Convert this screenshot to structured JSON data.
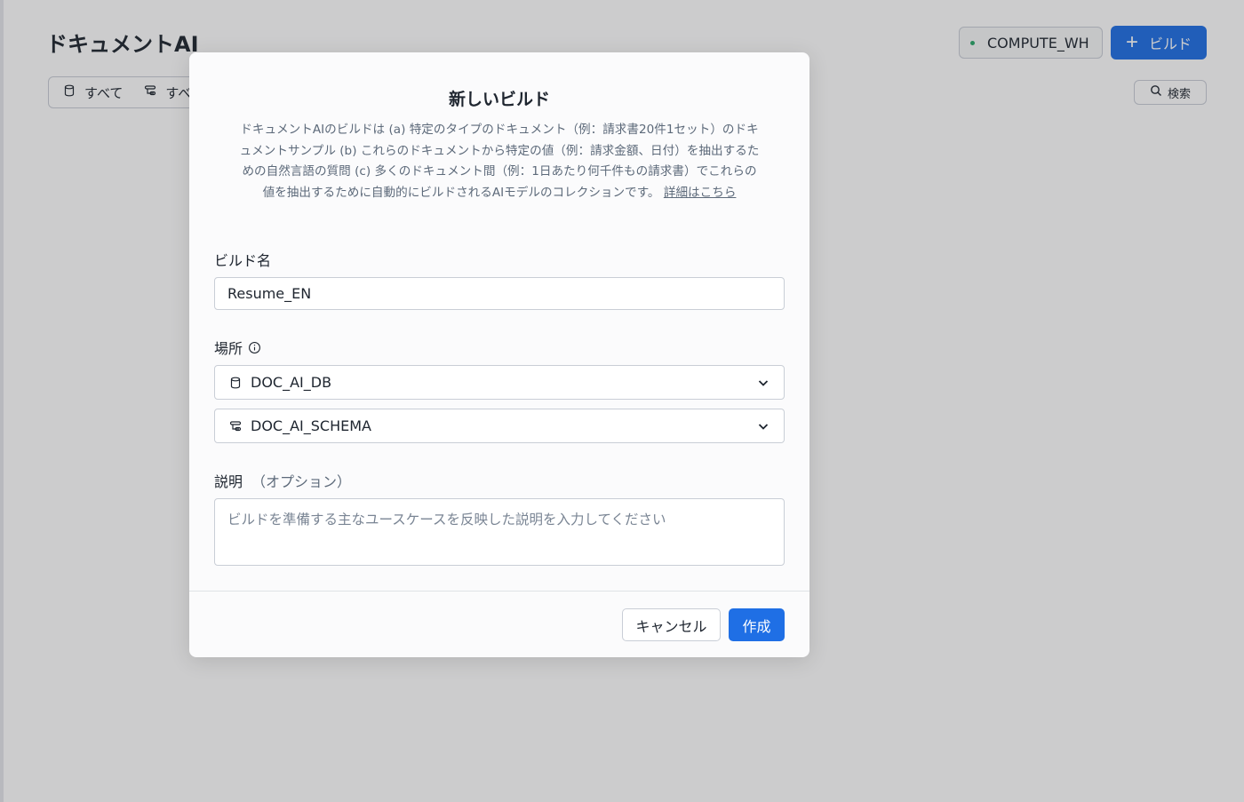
{
  "page": {
    "title": "ドキュメントAI",
    "filters": [
      {
        "icon": "database-icon",
        "label": "すべて"
      },
      {
        "icon": "schema-icon",
        "label": "すべ"
      }
    ],
    "warehouse": {
      "label": "COMPUTE_WH",
      "status_color": "#2aa76a"
    },
    "build_button": {
      "label": "ビルド",
      "icon": "plus-icon"
    },
    "search_button": {
      "label": "検索",
      "icon": "search-icon"
    }
  },
  "modal": {
    "title": "新しいビルド",
    "description": "ドキュメントAIのビルドは (a) 特定のタイプのドキュメント（例：請求書20件1セット）のドキュメントサンプル (b) これらのドキュメントから特定の値（例：請求金額、日付）を抽出するための自然言語の質問 (c) 多くのドキュメント間（例：1日あたり何千件もの請求書）でこれらの値を抽出するために自動的にビルドされるAIモデルのコレクションです。",
    "learn_more": "詳細はこちら",
    "build_name": {
      "label": "ビルド名",
      "value": "Resume_EN"
    },
    "location": {
      "label": "場所",
      "database": {
        "icon": "database-icon",
        "value": "DOC_AI_DB"
      },
      "schema": {
        "icon": "schema-icon",
        "value": "DOC_AI_SCHEMA"
      }
    },
    "description_field": {
      "label": "説明",
      "optional": "（オプション）",
      "placeholder": "ビルドを準備する主なユースケースを反映した説明を入力してください",
      "value": ""
    },
    "cancel_label": "キャンセル",
    "create_label": "作成"
  },
  "colors": {
    "accent": "#1f6fe5",
    "overlay": "rgba(40,42,45,0.24)"
  }
}
